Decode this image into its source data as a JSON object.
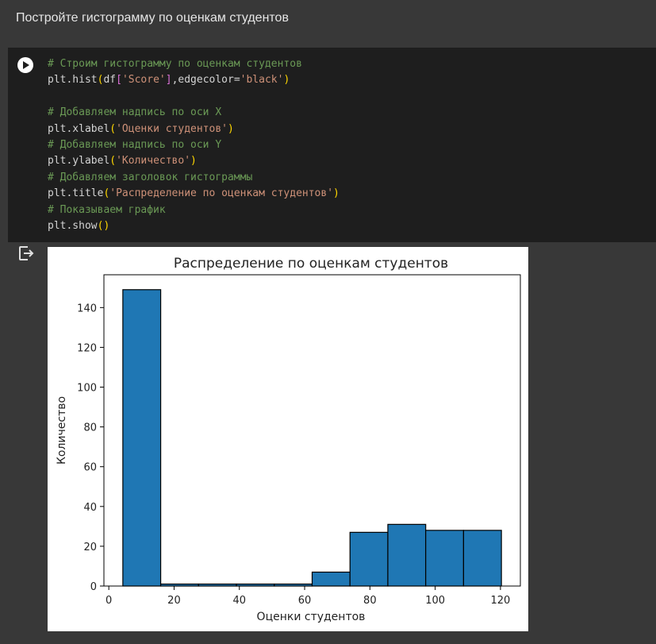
{
  "text_cell": {
    "text": "Постройте гистограмму по оценкам студентов"
  },
  "code_cell": {
    "lines": [
      [
        {
          "t": "# Строим гистограмму по оценкам студентов",
          "c": "com"
        }
      ],
      [
        {
          "t": "plt.hist",
          "c": "plain"
        },
        {
          "t": "(",
          "c": "br1"
        },
        {
          "t": "df",
          "c": "plain"
        },
        {
          "t": "[",
          "c": "br2"
        },
        {
          "t": "'Score'",
          "c": "str"
        },
        {
          "t": "]",
          "c": "br2"
        },
        {
          "t": ",edgecolor=",
          "c": "plain"
        },
        {
          "t": "'black'",
          "c": "str"
        },
        {
          "t": ")",
          "c": "br1"
        }
      ],
      [],
      [
        {
          "t": "# Добавляем надпись по оси X",
          "c": "com"
        }
      ],
      [
        {
          "t": "plt.xlabel",
          "c": "plain"
        },
        {
          "t": "(",
          "c": "br1"
        },
        {
          "t": "'Оценки студентов'",
          "c": "str"
        },
        {
          "t": ")",
          "c": "br1"
        }
      ],
      [
        {
          "t": "# Добавляем надпись по оси Y",
          "c": "com"
        }
      ],
      [
        {
          "t": "plt.ylabel",
          "c": "plain"
        },
        {
          "t": "(",
          "c": "br1"
        },
        {
          "t": "'Количество'",
          "c": "str"
        },
        {
          "t": ")",
          "c": "br1"
        }
      ],
      [
        {
          "t": "# Добавляем заголовок гистограммы",
          "c": "com"
        }
      ],
      [
        {
          "t": "plt.title",
          "c": "plain"
        },
        {
          "t": "(",
          "c": "br1"
        },
        {
          "t": "'Распределение по оценкам студентов'",
          "c": "str"
        },
        {
          "t": ")",
          "c": "br1"
        }
      ],
      [
        {
          "t": "# Показываем график",
          "c": "com"
        }
      ],
      [
        {
          "t": "plt.show",
          "c": "plain"
        },
        {
          "t": "()",
          "c": "br1"
        }
      ]
    ]
  },
  "chart_data": {
    "type": "bar",
    "title": "Распределение по оценкам студентов",
    "xlabel": "Оценки студентов",
    "ylabel": "Количество",
    "bins": [
      {
        "x0": 4.3,
        "x1": 15.9,
        "count": 149
      },
      {
        "x0": 15.9,
        "x1": 27.5,
        "count": 1
      },
      {
        "x0": 27.5,
        "x1": 39.1,
        "count": 1
      },
      {
        "x0": 39.1,
        "x1": 50.7,
        "count": 1
      },
      {
        "x0": 50.7,
        "x1": 62.3,
        "count": 1
      },
      {
        "x0": 62.3,
        "x1": 73.9,
        "count": 7
      },
      {
        "x0": 73.9,
        "x1": 85.5,
        "count": 27
      },
      {
        "x0": 85.5,
        "x1": 97.1,
        "count": 31
      },
      {
        "x0": 97.1,
        "x1": 108.7,
        "count": 28
      },
      {
        "x0": 108.7,
        "x1": 120.3,
        "count": 28
      }
    ],
    "xlim": [
      -1.5,
      126.1
    ],
    "ylim": [
      0,
      156.5
    ],
    "xticks": [
      0,
      20,
      40,
      60,
      80,
      100,
      120
    ],
    "yticks": [
      0,
      20,
      40,
      60,
      80,
      100,
      120,
      140
    ],
    "bar_color": "#1f77b4",
    "edge_color": "#000000",
    "grid": false
  }
}
